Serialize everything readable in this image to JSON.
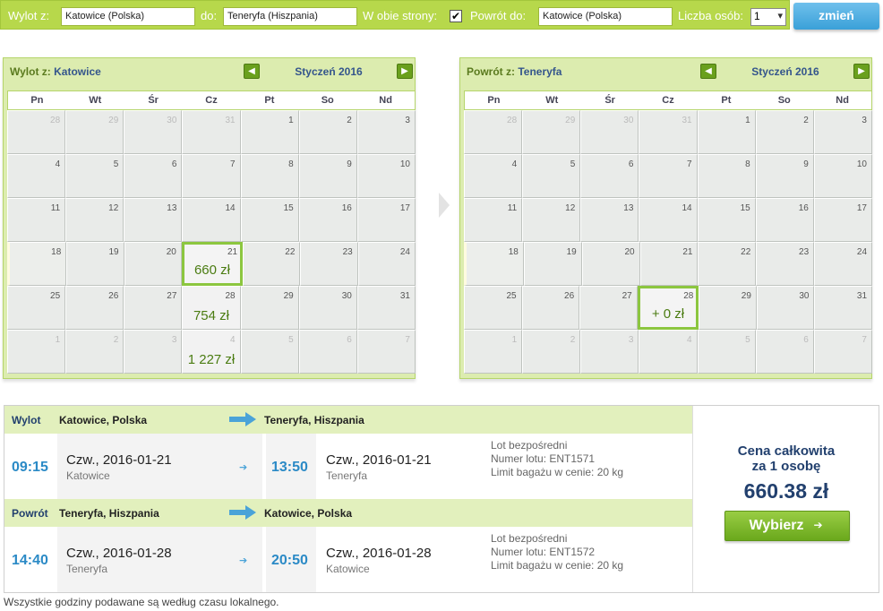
{
  "search": {
    "from_label": "Wylot z:",
    "from_value": "Katowice (Polska)",
    "to_label": "do:",
    "to_value": "Teneryfa (Hiszpania)",
    "round_trip_label": "W obie strony:",
    "round_trip_checked": true,
    "return_label": "Powrót do:",
    "return_value": "Katowice (Polska)",
    "people_label": "Liczba osób:",
    "people_value": "1",
    "change_button": "zmień"
  },
  "outbound_calendar": {
    "title_prefix": "Wylot z:",
    "title_city": "Katowice",
    "month": "Styczeń 2016",
    "weekdays": [
      "Pn",
      "Wt",
      "Śr",
      "Cz",
      "Pt",
      "So",
      "Nd"
    ],
    "weeks": [
      [
        {
          "d": "28",
          "o": true
        },
        {
          "d": "29",
          "o": true
        },
        {
          "d": "30",
          "o": true
        },
        {
          "d": "31",
          "o": true
        },
        {
          "d": "1"
        },
        {
          "d": "2"
        },
        {
          "d": "3"
        }
      ],
      [
        {
          "d": "4"
        },
        {
          "d": "5"
        },
        {
          "d": "6"
        },
        {
          "d": "7"
        },
        {
          "d": "8"
        },
        {
          "d": "9"
        },
        {
          "d": "10"
        }
      ],
      [
        {
          "d": "11"
        },
        {
          "d": "12"
        },
        {
          "d": "13"
        },
        {
          "d": "14"
        },
        {
          "d": "15"
        },
        {
          "d": "16"
        },
        {
          "d": "17"
        }
      ],
      [
        {
          "d": "18",
          "t": true
        },
        {
          "d": "19"
        },
        {
          "d": "20"
        },
        {
          "d": "21",
          "p": "660 zł",
          "s": true
        },
        {
          "d": "22"
        },
        {
          "d": "23"
        },
        {
          "d": "24"
        }
      ],
      [
        {
          "d": "25"
        },
        {
          "d": "26"
        },
        {
          "d": "27"
        },
        {
          "d": "28",
          "p": "754 zł"
        },
        {
          "d": "29"
        },
        {
          "d": "30"
        },
        {
          "d": "31"
        }
      ],
      [
        {
          "d": "1",
          "o": true
        },
        {
          "d": "2",
          "o": true
        },
        {
          "d": "3",
          "o": true
        },
        {
          "d": "4",
          "o": true,
          "p": "1 227 zł"
        },
        {
          "d": "5",
          "o": true
        },
        {
          "d": "6",
          "o": true
        },
        {
          "d": "7",
          "o": true
        }
      ]
    ]
  },
  "return_calendar": {
    "title_prefix": "Powrót z:",
    "title_city": "Teneryfa",
    "month": "Styczeń 2016",
    "weekdays": [
      "Pn",
      "Wt",
      "Śr",
      "Cz",
      "Pt",
      "So",
      "Nd"
    ],
    "weeks": [
      [
        {
          "d": "28",
          "o": true
        },
        {
          "d": "29",
          "o": true
        },
        {
          "d": "30",
          "o": true
        },
        {
          "d": "31",
          "o": true
        },
        {
          "d": "1"
        },
        {
          "d": "2"
        },
        {
          "d": "3"
        }
      ],
      [
        {
          "d": "4"
        },
        {
          "d": "5"
        },
        {
          "d": "6"
        },
        {
          "d": "7"
        },
        {
          "d": "8"
        },
        {
          "d": "9"
        },
        {
          "d": "10"
        }
      ],
      [
        {
          "d": "11"
        },
        {
          "d": "12"
        },
        {
          "d": "13"
        },
        {
          "d": "14"
        },
        {
          "d": "15"
        },
        {
          "d": "16"
        },
        {
          "d": "17"
        }
      ],
      [
        {
          "d": "18",
          "t": true
        },
        {
          "d": "19"
        },
        {
          "d": "20"
        },
        {
          "d": "21"
        },
        {
          "d": "22"
        },
        {
          "d": "23"
        },
        {
          "d": "24"
        }
      ],
      [
        {
          "d": "25"
        },
        {
          "d": "26"
        },
        {
          "d": "27"
        },
        {
          "d": "28",
          "p": "+ 0 zł",
          "s": true
        },
        {
          "d": "29"
        },
        {
          "d": "30"
        },
        {
          "d": "31"
        }
      ],
      [
        {
          "d": "1",
          "o": true
        },
        {
          "d": "2",
          "o": true
        },
        {
          "d": "3",
          "o": true
        },
        {
          "d": "4",
          "o": true
        },
        {
          "d": "5",
          "o": true
        },
        {
          "d": "6",
          "o": true
        },
        {
          "d": "7",
          "o": true
        }
      ]
    ]
  },
  "outbound": {
    "label": "Wylot",
    "from": "Katowice, Polska",
    "to": "Teneryfa, Hiszpania",
    "dep_time": "09:15",
    "dep_date": "Czw., 2016-01-21",
    "dep_city": "Katowice",
    "arr_time": "13:50",
    "arr_date": "Czw., 2016-01-21",
    "arr_city": "Teneryfa",
    "info1": "Lot bezpośredni",
    "info2": "Numer lotu: ENT1571",
    "info3": "Limit bagażu w cenie: 20 kg"
  },
  "return": {
    "label": "Powrót",
    "from": "Teneryfa, Hiszpania",
    "to": "Katowice, Polska",
    "dep_time": "14:40",
    "dep_date": "Czw., 2016-01-28",
    "dep_city": "Teneryfa",
    "arr_time": "20:50",
    "arr_date": "Czw., 2016-01-28",
    "arr_city": "Katowice",
    "info1": "Lot bezpośredni",
    "info2": "Numer lotu: ENT1572",
    "info3": "Limit bagażu w cenie: 20 kg"
  },
  "price": {
    "line1": "Cena całkowita",
    "line2": "za 1 osobę",
    "amount": "660.38 zł",
    "button": "Wybierz"
  },
  "footnote": "Wszystkie godziny podawane są według czasu lokalnego.",
  "colors": {
    "accent_green": "#b7d84b",
    "button_blue": "#3aa0d8",
    "price_navy": "#22406e"
  }
}
